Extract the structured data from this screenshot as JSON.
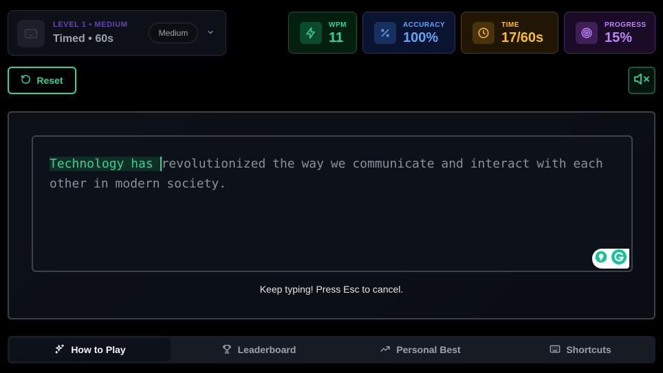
{
  "level": {
    "subtitle": "LEVEL 1 • MEDIUM",
    "title": "Timed • 60s",
    "difficulty": "Medium",
    "icon": "keyboard-icon"
  },
  "stats": {
    "wpm": {
      "label": "WPM",
      "value": "11",
      "icon": "lightning-icon",
      "color": "#34d399"
    },
    "accuracy": {
      "label": "ACCURACY",
      "value": "100%",
      "icon": "percent-icon",
      "color": "#60a5fa"
    },
    "time": {
      "label": "TIME",
      "value": "17/60s",
      "icon": "clock-icon",
      "color": "#fbbf24"
    },
    "progress": {
      "label": "PROGRESS",
      "value": "15%",
      "icon": "target-icon",
      "color": "#c084fc"
    }
  },
  "controls": {
    "reset_label": "Reset",
    "mute_icon": "volume-mute-icon"
  },
  "passage": {
    "typed": "Technology has ",
    "current": "r",
    "remaining": "evolutionized the way we communicate and interact with each other in modern society."
  },
  "hint": "Keep typing! Press Esc to cancel.",
  "nav": [
    {
      "label": "How to Play",
      "icon": "sparkles-icon",
      "active": true
    },
    {
      "label": "Leaderboard",
      "icon": "trophy-icon",
      "active": false
    },
    {
      "label": "Personal Best",
      "icon": "trending-up-icon",
      "active": false
    },
    {
      "label": "Shortcuts",
      "icon": "keyboard-icon",
      "active": false
    }
  ]
}
